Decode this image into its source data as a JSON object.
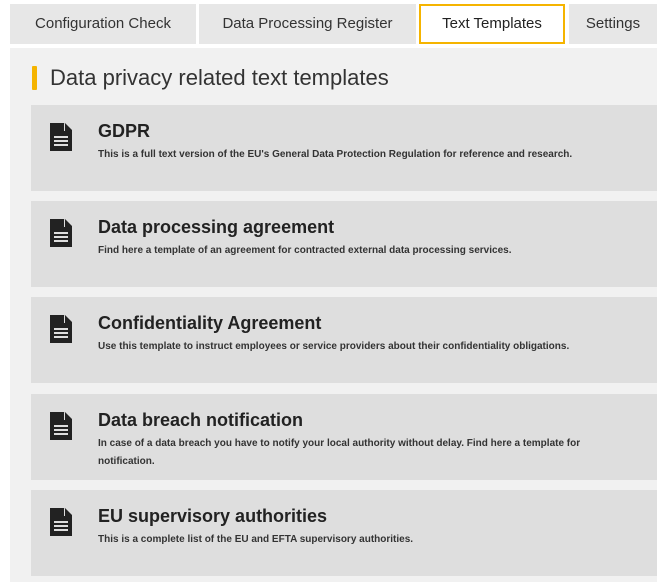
{
  "tabs": [
    {
      "label": "Configuration Check"
    },
    {
      "label": "Data Processing Register"
    },
    {
      "label": "Text Templates",
      "active": true
    },
    {
      "label": "Settings"
    }
  ],
  "page": {
    "heading": "Data privacy related text templates"
  },
  "templates": [
    {
      "icon": "document-icon",
      "title": "GDPR",
      "description": "This is a full text version of the EU's General Data Protection Regulation for reference and research."
    },
    {
      "icon": "document-icon",
      "title": "Data processing agreement",
      "description": "Find here a template of an agreement for contracted external data processing services."
    },
    {
      "icon": "document-icon",
      "title": "Confidentiality Agreement",
      "description": "Use this template to instruct employees or service providers about their confidentiality obligations."
    },
    {
      "icon": "document-icon",
      "title": "Data breach notification",
      "description": "In case of a data breach you have to notify your local authority without delay. Find here a template for notification."
    },
    {
      "icon": "document-icon",
      "title": "EU supervisory authorities",
      "description": "This is a complete list of the EU and EFTA supervisory authorities."
    }
  ],
  "colors": {
    "accent": "#f5b400",
    "panel_background": "#f1f1f1",
    "card_background": "#dedede",
    "tab_background": "#e7e7e7"
  }
}
